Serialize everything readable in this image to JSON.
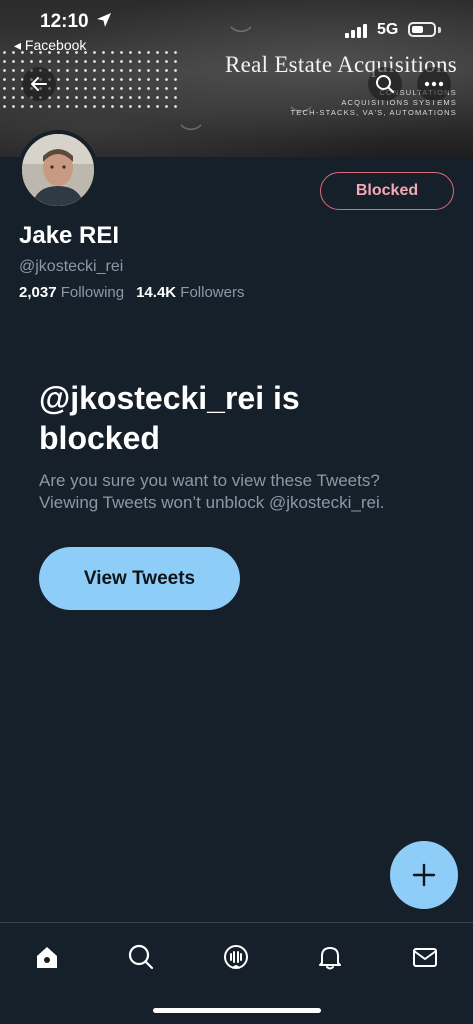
{
  "status_bar": {
    "time": "12:10",
    "back_app": "◂ Facebook",
    "network": "5G"
  },
  "banner": {
    "title": "Real Estate Acquisitions",
    "tags": [
      "CONSULTATIONS",
      "ACQUISITIONS SYSTEMS",
      "TECH-STACKS, VA'S, AUTOMATIONS"
    ]
  },
  "profile": {
    "display_name": "Jake REI",
    "handle": "@jkostecki_rei",
    "following_count": "2,037",
    "following_label": "Following",
    "followers_count": "14.4K",
    "followers_label": "Followers",
    "blocked_button_label": "Blocked"
  },
  "blocked_notice": {
    "title": "@jkostecki_rei is blocked",
    "description": "Are you sure you want to view these Tweets? Viewing Tweets won’t unblock @jkostecki_rei.",
    "view_button_label": "View Tweets"
  },
  "icons": {
    "back": "arrow-left-icon",
    "search": "search-icon",
    "more": "more-horizontal-icon",
    "compose": "plus-icon",
    "nav": [
      "home-icon",
      "search-icon",
      "spaces-icon",
      "bell-icon",
      "mail-icon"
    ]
  },
  "colors": {
    "background": "#15202b",
    "accent": "#8ecdf8",
    "blocked": "#e0687a",
    "muted_text": "#8b98a5"
  }
}
